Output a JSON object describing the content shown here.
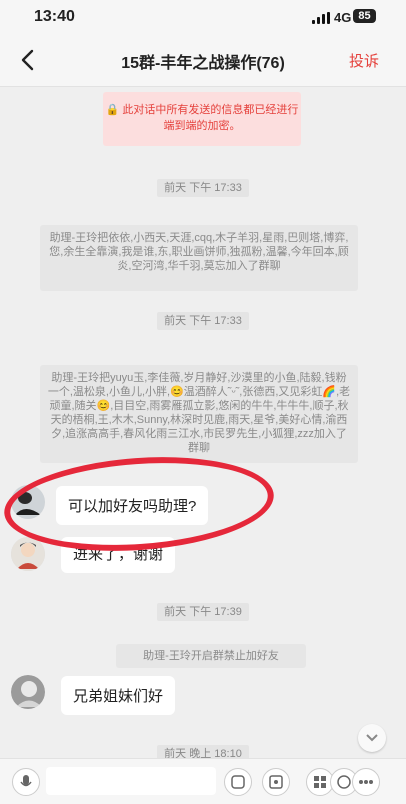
{
  "status": {
    "time": "13:40",
    "network": "4G",
    "battery": "85"
  },
  "header": {
    "title": "15群-丰年之战操作(76)",
    "complain": "投诉"
  },
  "encryption_notice": "🔒 此对话中所有发送的信息都已经进行端到端的加密。",
  "messages": {
    "ts1": "前天 下午 17:33",
    "sys1": "助理-王玲把依依,小西天,天涯,cqq,木子羊羽,星雨,巴则塔,博弈,您,余生全靠演,我是谁,东,职业画饼师,独孤粉,温馨,今年回本,顾炎,空河湾,华千羽,莫忘加入了群聊",
    "ts2": "前天 下午 17:33",
    "sys2": "助理-王玲把yuyu玉,李佳薇,岁月静好,沙漠里的小鱼,陆毅,钱粉一个,温松泉,小鱼儿,小胖,😊温酒醉人˜ᵕ˜,张德西,又见彩虹🌈,老顽童,随关😊,目目空,雨雾雁孤立影,悠闲的牛牛,牛牛牛,顺子,秋天的梧桐,王,木木,Sunny,林深时见鹿,雨天,星爷,美好心情,渝西夕,追涨高高手,春风化雨三江水,市民罗先生,小狐狸,zzz加入了群聊",
    "bubble1": "可以加好友吗助理?",
    "bubble2": "进来了，谢谢",
    "ts3": "前天 下午 17:39",
    "sys3": "助理-王玲开启群禁止加好友",
    "bubble3": "兄弟姐妹们好",
    "ts4": "前天 晚上 18:10"
  }
}
